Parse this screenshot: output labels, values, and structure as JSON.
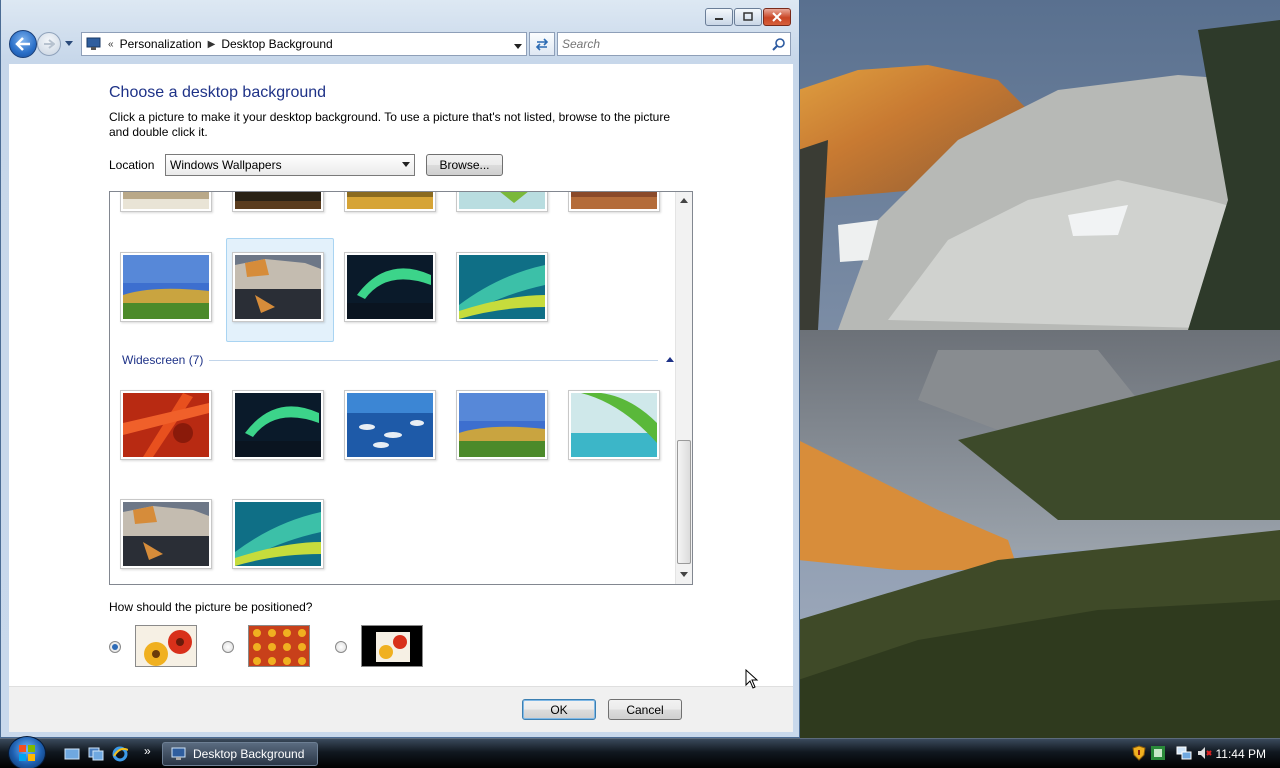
{
  "window": {
    "breadcrumb": [
      "Personalization",
      "Desktop Background"
    ],
    "search_placeholder": "Search"
  },
  "content": {
    "title": "Choose a desktop background",
    "description": "Click a picture to make it your desktop background. To use a picture that's not listed, browse to the picture and double click it.",
    "location_label": "Location",
    "location_value": "Windows Wallpapers",
    "browse_label": "Browse...",
    "group_label": "Widescreen (7)",
    "position_question": "How should the picture be positioned?",
    "position_selected": "fit"
  },
  "buttons": {
    "ok": "OK",
    "cancel": "Cancel"
  },
  "taskbar": {
    "active_task": "Desktop Background",
    "clock": "11:44 PM",
    "overflow": "»"
  },
  "icons": {
    "back": "back-arrow-icon",
    "forward": "forward-arrow-icon",
    "refresh": "refresh-icon",
    "search": "search-magnifier-icon",
    "start": "windows-start-orb-icon"
  },
  "colors": {
    "title": "#1e3287",
    "selection": "#e3f1fb",
    "group_line": "#c2d5ea"
  }
}
